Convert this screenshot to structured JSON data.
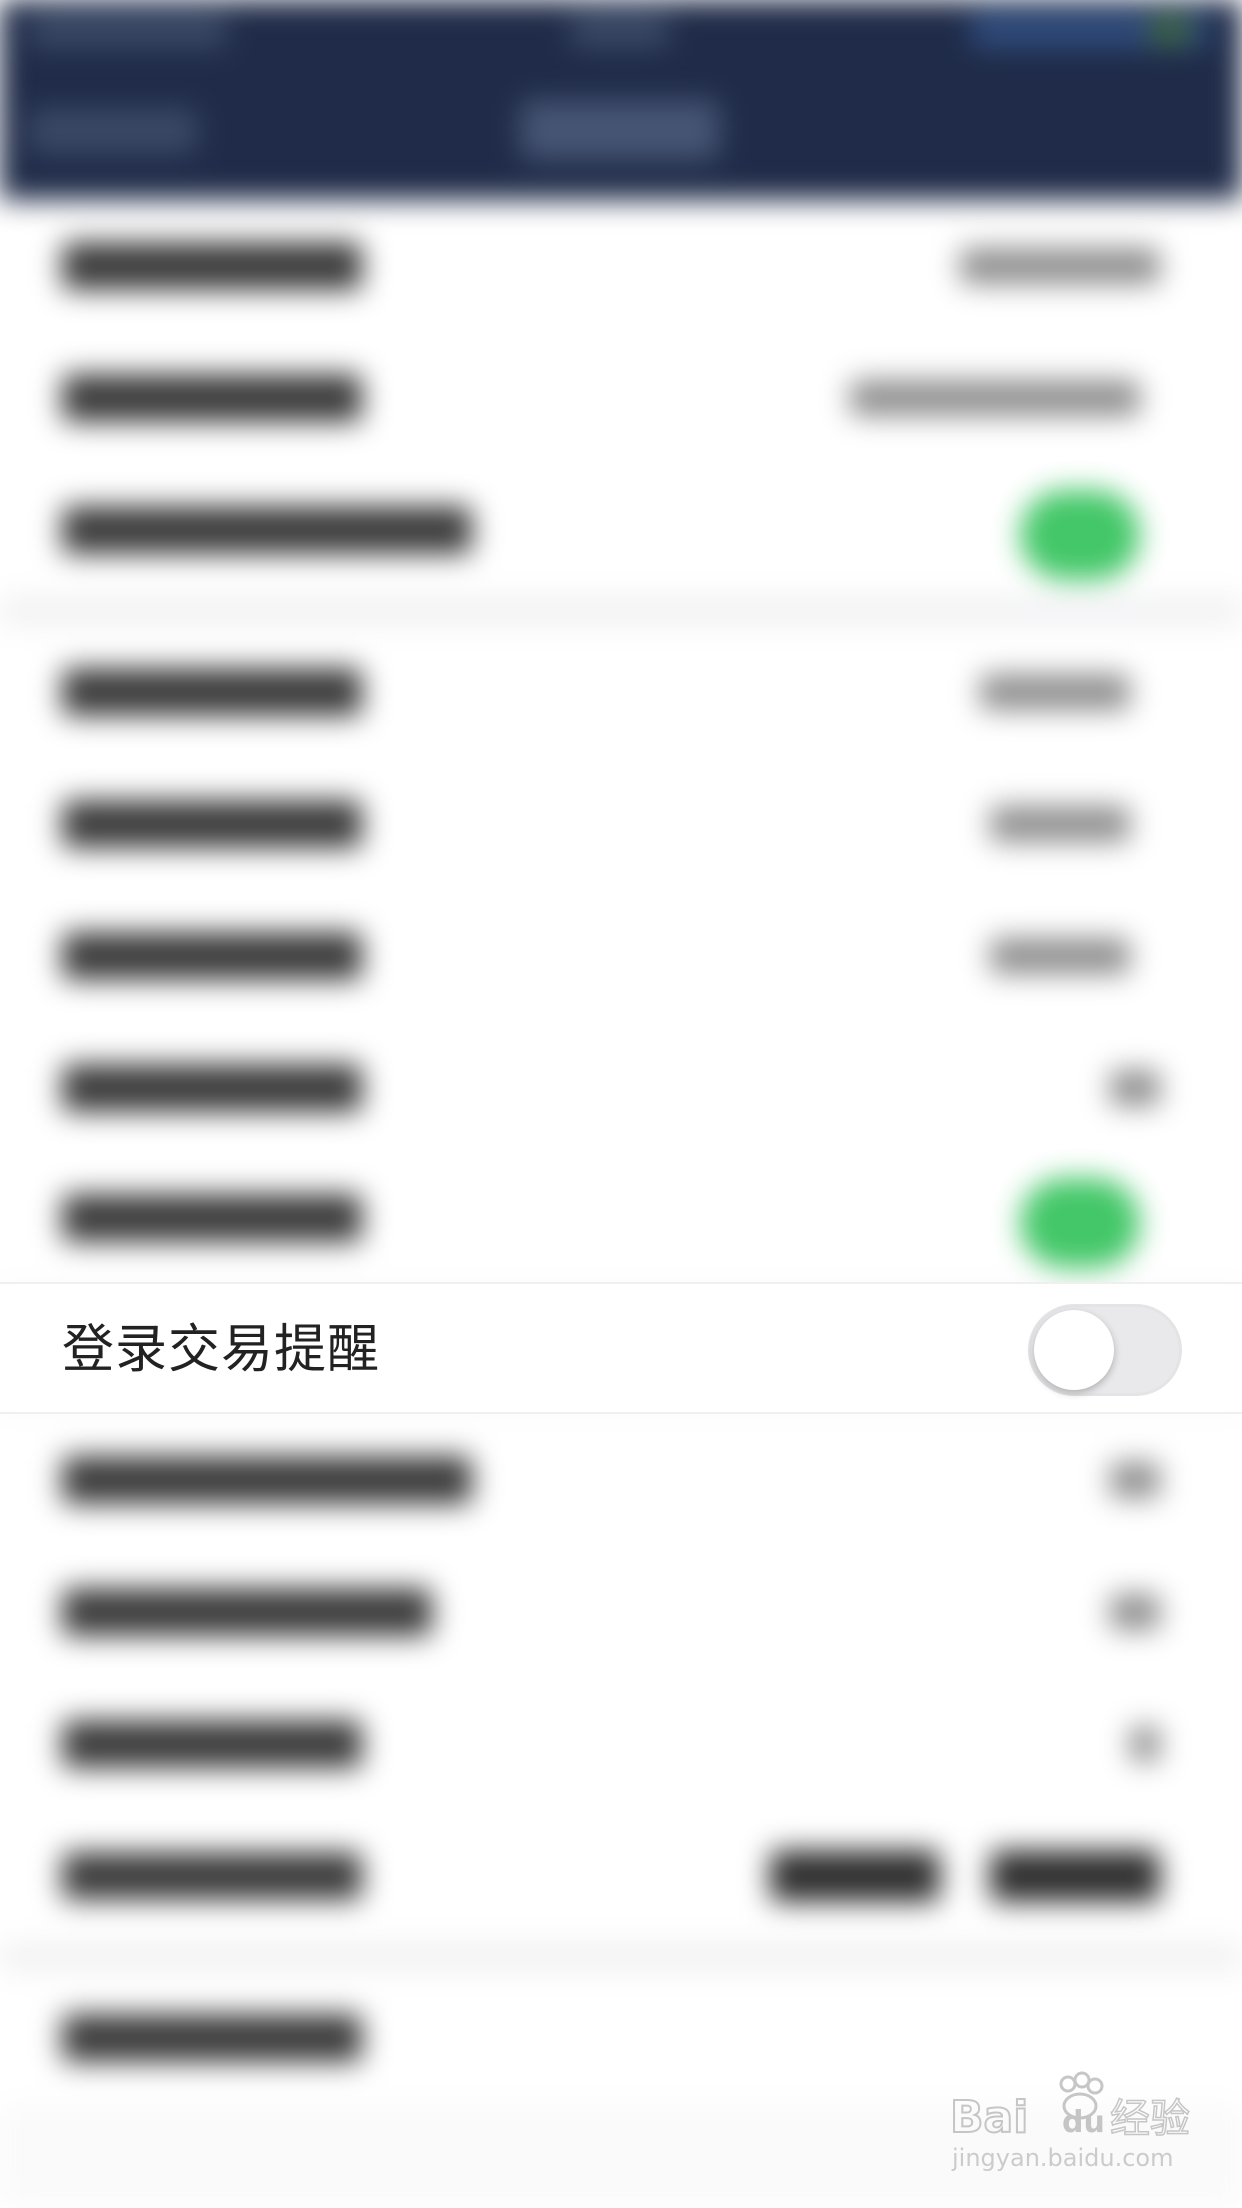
{
  "settings": {
    "login_trade_reminder": {
      "label": "登录交易提醒",
      "enabled": false
    }
  },
  "colors": {
    "nav_background": "#1f2b48",
    "toggle_on": "#43c768",
    "toggle_off": "#e9e9eb"
  },
  "watermark": {
    "brand": "Bai du 经验",
    "url": "jingyan.baidu.com"
  }
}
